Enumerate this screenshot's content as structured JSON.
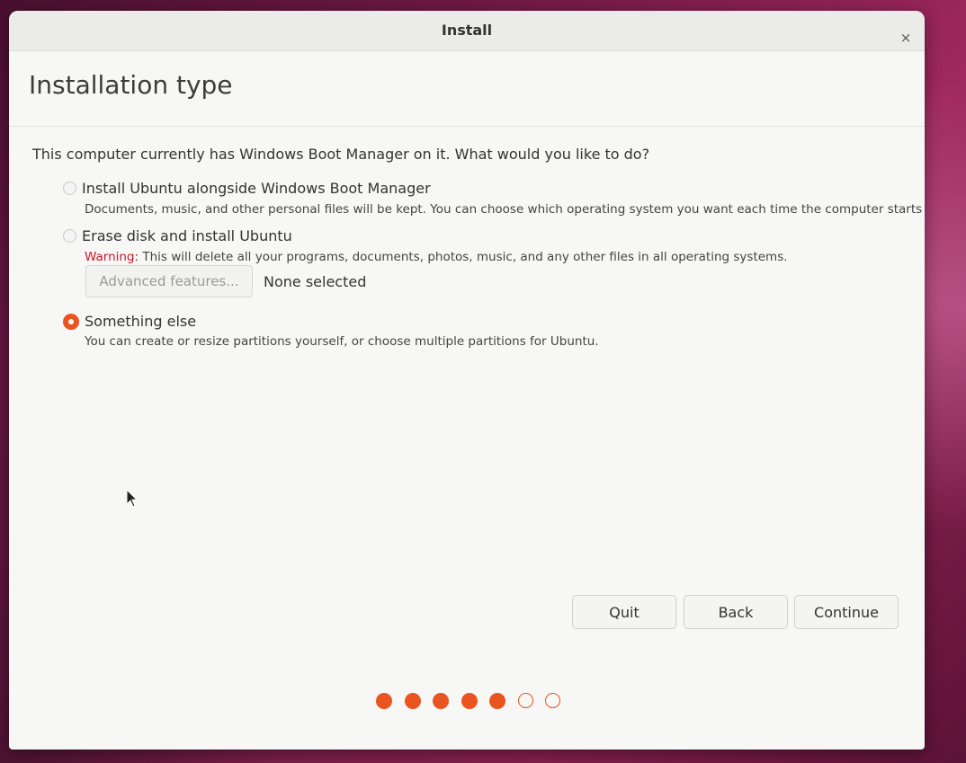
{
  "window": {
    "title": "Install",
    "close_glyph": "×"
  },
  "page": {
    "title": "Installation type",
    "question": "This computer currently has Windows Boot Manager on it. What would you like to do?"
  },
  "options": [
    {
      "label": "Install Ubuntu alongside Windows Boot Manager",
      "description": "Documents, music, and other personal files will be kept. You can choose which operating system you want each time the computer starts up.",
      "selected": false
    },
    {
      "label": "Erase disk and install Ubuntu",
      "warning_prefix": "Warning:",
      "description": " This will delete all your programs, documents, photos, music, and any other files in all operating systems.",
      "selected": false
    },
    {
      "label": "Something else",
      "description": "You can create or resize partitions yourself, or choose multiple partitions for Ubuntu.",
      "selected": true
    }
  ],
  "advanced": {
    "button_label": "Advanced features...",
    "status": "None selected",
    "enabled": false
  },
  "buttons": {
    "quit": "Quit",
    "back": "Back",
    "continue": "Continue"
  },
  "progress": {
    "total_steps": 7,
    "completed_steps": 5
  },
  "colors": {
    "accent": "#e95420",
    "warning": "#c7162b"
  },
  "icons": {
    "close": "close-icon",
    "cursor": "mouse-pointer-icon"
  }
}
